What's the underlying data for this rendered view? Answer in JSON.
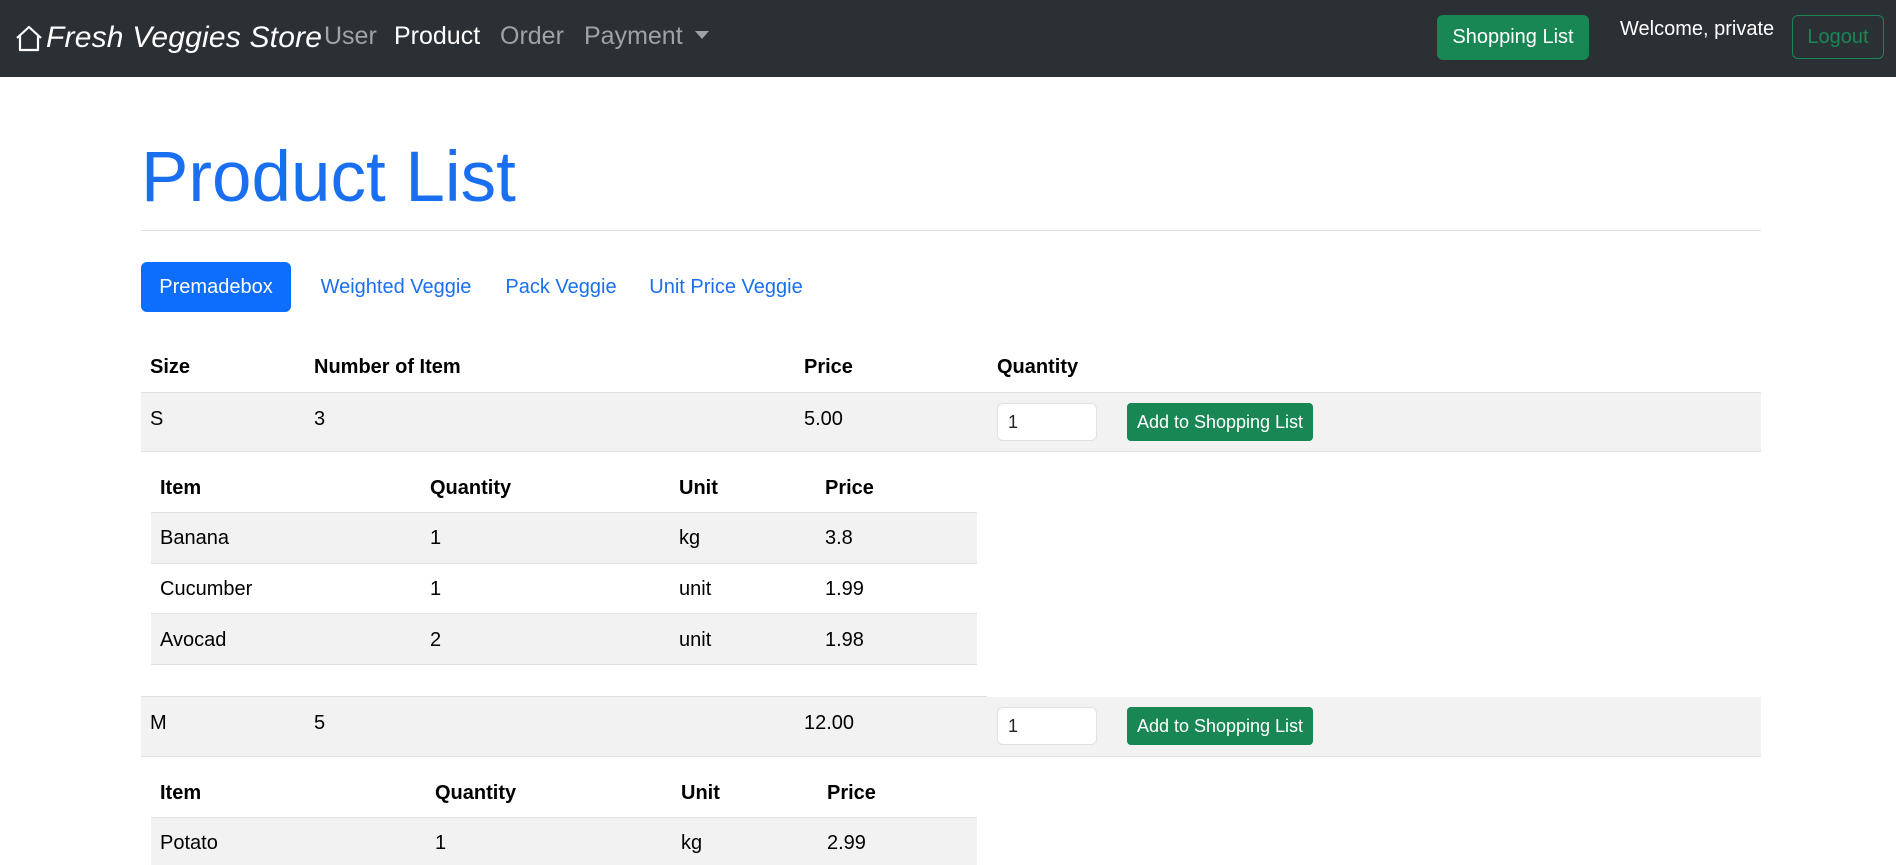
{
  "navbar": {
    "brand": "Fresh Veggies Store",
    "links": [
      {
        "label": "User",
        "active": false
      },
      {
        "label": "Product",
        "active": true
      },
      {
        "label": "Order",
        "active": false
      },
      {
        "label": "Payment",
        "active": false
      }
    ],
    "shopping_list_label": "Shopping List",
    "welcome_text": "Welcome, private",
    "logout_label": "Logout"
  },
  "page": {
    "title": "Product List",
    "tabs": [
      {
        "label": "Premadebox",
        "active": true
      },
      {
        "label": "Weighted Veggie",
        "active": false
      },
      {
        "label": "Pack Veggie",
        "active": false
      },
      {
        "label": "Unit Price Veggie",
        "active": false
      }
    ]
  },
  "product_table": {
    "headers": [
      "Size",
      "Number of Item",
      "Price",
      "Quantity"
    ],
    "add_label": "Add to Shopping List",
    "boxes": [
      {
        "size": "S",
        "number_of_item": "3",
        "price": "5.00",
        "quantity": "1",
        "items_headers": [
          "Item",
          "Quantity",
          "Unit",
          "Price"
        ],
        "items": [
          {
            "item": "Banana",
            "quantity": "1",
            "unit": "kg",
            "price": "3.8"
          },
          {
            "item": "Cucumber",
            "quantity": "1",
            "unit": "unit",
            "price": "1.99"
          },
          {
            "item": "Avocad",
            "quantity": "2",
            "unit": "unit",
            "price": "1.98"
          }
        ]
      },
      {
        "size": "M",
        "number_of_item": "5",
        "price": "12.00",
        "quantity": "1",
        "items_headers": [
          "Item",
          "Quantity",
          "Unit",
          "Price"
        ],
        "items": [
          {
            "item": "Potato",
            "quantity": "1",
            "unit": "kg",
            "price": "2.99"
          }
        ]
      }
    ]
  },
  "colors": {
    "navbar_bg": "#2b3035",
    "primary": "#0d6efd",
    "success": "#198754",
    "title": "#1a6ff0",
    "stripe": "#f2f2f2"
  }
}
